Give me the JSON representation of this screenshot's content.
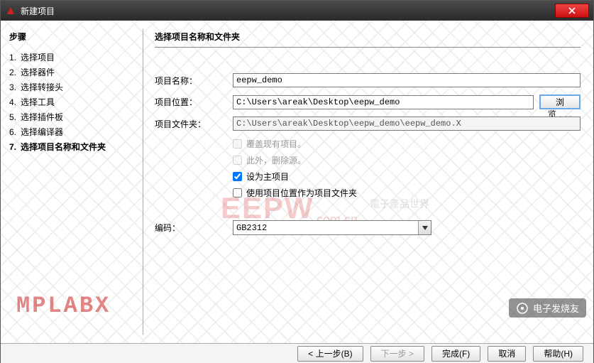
{
  "window": {
    "title": "新建项目"
  },
  "sidebar": {
    "title": "步骤",
    "steps": [
      {
        "num": "1.",
        "label": "选择项目"
      },
      {
        "num": "2.",
        "label": "选择器件"
      },
      {
        "num": "3.",
        "label": "选择转接头"
      },
      {
        "num": "4.",
        "label": "选择工具"
      },
      {
        "num": "5.",
        "label": "选择插件板"
      },
      {
        "num": "6.",
        "label": "选择编译器"
      },
      {
        "num": "7.",
        "label": "选择项目名称和文件夹"
      }
    ],
    "current_index": 6
  },
  "main": {
    "title": "选择项目名称和文件夹",
    "labels": {
      "project_name": "项目名称：",
      "project_location": "项目位置：",
      "project_folder": "项目文件夹：",
      "browse": "浏览...",
      "encoding": "编码："
    },
    "values": {
      "project_name": "eepw_demo",
      "project_location": "C:\\Users\\areak\\Desktop\\eepw_demo",
      "project_folder": "C:\\Users\\areak\\Desktop\\eepw_demo\\eepw_demo.X",
      "encoding": "GB2312"
    },
    "checks": {
      "overwrite": {
        "label": "覆盖现有项目。",
        "checked": false,
        "enabled": false
      },
      "delete_source": {
        "label": "此外，删除源。",
        "checked": false,
        "enabled": false
      },
      "set_main": {
        "label": "设为主项目",
        "checked": true,
        "enabled": true
      },
      "use_location": {
        "label": "使用项目位置作为项目文件夹",
        "checked": false,
        "enabled": true
      }
    }
  },
  "footer": {
    "back": "< 上一步(B)",
    "next": "下一步 >",
    "finish": "完成(F)",
    "cancel": "取消",
    "help": "帮助(H)"
  },
  "watermarks": {
    "mplabx": "MPLABX",
    "eepw": "EEPW",
    "eepw_sub": ".com.cn",
    "eepw_cn": "電子產品世界",
    "elecfans": "电子发烧友"
  }
}
